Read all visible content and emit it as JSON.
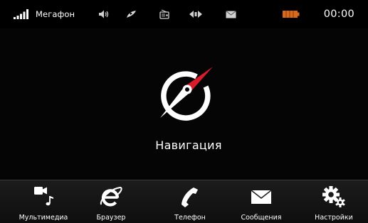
{
  "status_bar": {
    "operator": "Мегафон",
    "time": "00:00",
    "icons": [
      "signal-icon",
      "volume-icon",
      "dial-icon",
      "radio-icon",
      "nav-arrows-icon",
      "mail-icon",
      "battery-icon"
    ],
    "battery_color": "#d86a1c"
  },
  "main": {
    "app_label": "Навигация",
    "app_icon": "compass-icon",
    "accent_color": "#d81c2a"
  },
  "dock": {
    "items": [
      {
        "label": "Мультимедиа",
        "icon": "multimedia-icon"
      },
      {
        "label": "Браузер",
        "icon": "browser-icon"
      },
      {
        "label": "Телефон",
        "icon": "phone-icon"
      },
      {
        "label": "Сообщения",
        "icon": "messages-icon"
      },
      {
        "label": "Настройки",
        "icon": "settings-icon"
      }
    ]
  }
}
